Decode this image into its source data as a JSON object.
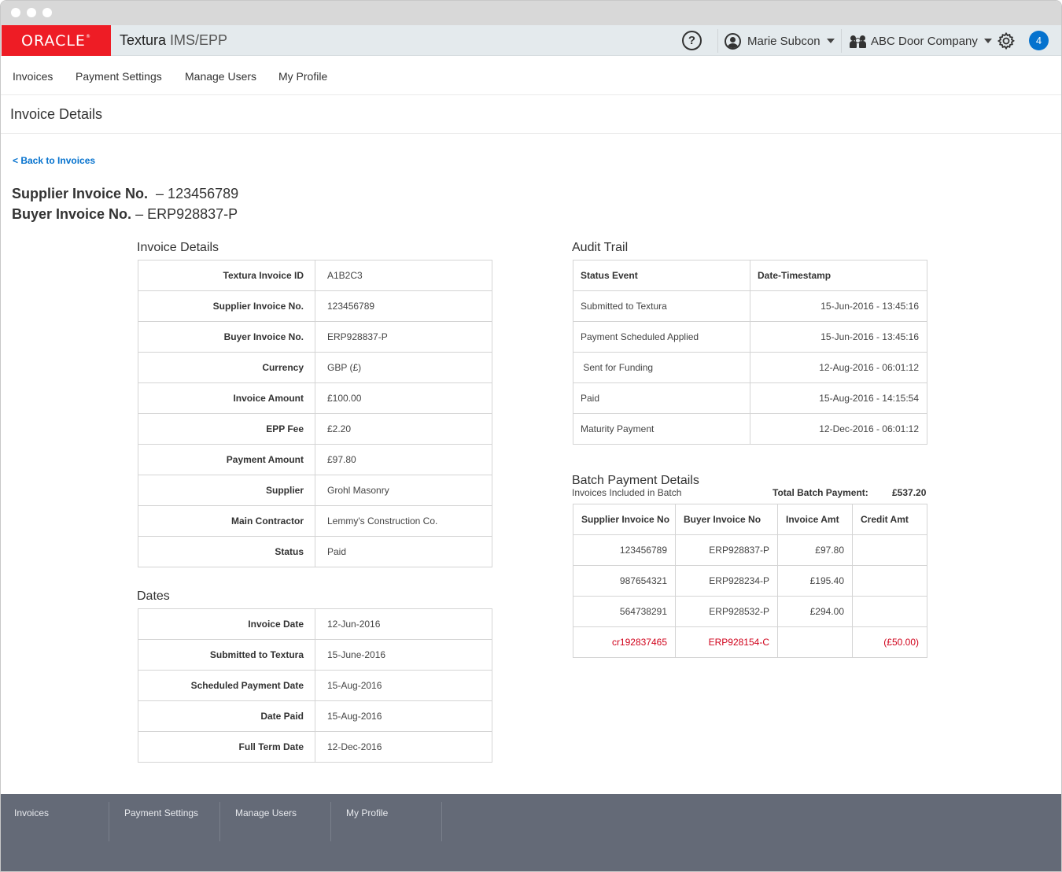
{
  "window": {
    "colors": {
      "titlebar": "#d8d8d8",
      "dots": "#ffffff"
    }
  },
  "topbar": {
    "brand": "ORACLE",
    "brand_color": "#ee1c25",
    "app_title": "Textura",
    "app_title_suffix": " IMS/EPP",
    "help_label": "?",
    "user_name": "Marie Subcon",
    "company_name": "ABC Door Company",
    "notification_count": "4",
    "accent_color": "#0572ce"
  },
  "nav": {
    "items": [
      "Invoices",
      "Payment Settings",
      "Manage Users",
      "My Profile"
    ]
  },
  "page": {
    "title": "Invoice Details",
    "back_link": "< Back to Invoices",
    "supplier_label": "Supplier Invoice No.",
    "supplier_value": "– 123456789",
    "buyer_label": "Buyer Invoice No.",
    "buyer_value": "– ERP928837-P"
  },
  "invoice_details": {
    "title": "Invoice Details",
    "rows": [
      {
        "label": "Textura Invoice ID",
        "value": "A1B2C3"
      },
      {
        "label": "Supplier Invoice No.",
        "value": "123456789"
      },
      {
        "label": "Buyer Invoice No.",
        "value": "ERP928837-P"
      },
      {
        "label": "Currency",
        "value": "GBP (£)"
      },
      {
        "label": "Invoice Amount",
        "value": "£100.00"
      },
      {
        "label": "EPP Fee",
        "value": "£2.20"
      },
      {
        "label": "Payment Amount",
        "value": "£97.80"
      },
      {
        "label": "Supplier",
        "value": "Grohl Masonry"
      },
      {
        "label": "Main Contractor",
        "value": "Lemmy's Construction Co."
      },
      {
        "label": "Status",
        "value": "Paid"
      }
    ]
  },
  "dates": {
    "title": "Dates",
    "rows": [
      {
        "label": "Invoice Date",
        "value": "12-Jun-2016"
      },
      {
        "label": "Submitted to Textura",
        "value": "15-June-2016"
      },
      {
        "label": "Scheduled Payment Date",
        "value": "15-Aug-2016"
      },
      {
        "label": "Date Paid",
        "value": "15-Aug-2016"
      },
      {
        "label": "Full Term Date",
        "value": "12-Dec-2016"
      }
    ]
  },
  "audit_trail": {
    "title": "Audit Trail",
    "headers": [
      "Status Event",
      "Date-Timestamp"
    ],
    "rows": [
      {
        "event": "Submitted to Textura",
        "timestamp": "15-Jun-2016 - 13:45:16"
      },
      {
        "event": "Payment Scheduled Applied",
        "timestamp": "15-Jun-2016 - 13:45:16"
      },
      {
        "event": " Sent for Funding",
        "timestamp": "12-Aug-2016 - 06:01:12"
      },
      {
        "event": "Paid",
        "timestamp": "15-Aug-2016 - 14:15:54"
      },
      {
        "event": "Maturity Payment",
        "timestamp": "12-Dec-2016 - 06:01:12"
      }
    ]
  },
  "batch": {
    "title": "Batch Payment Details",
    "subtitle": "Invoices Included in Batch",
    "total_label": "Total Batch Payment:",
    "total_value": "£537.20",
    "headers": [
      "Supplier Invoice No",
      "Buyer Invoice No",
      "Invoice Amt",
      "Credit Amt"
    ],
    "credit_color": "#d0021b",
    "rows": [
      {
        "supplier": "123456789",
        "buyer": "ERP928837-P",
        "amount": "£97.80",
        "credit": "",
        "is_credit": false
      },
      {
        "supplier": "987654321",
        "buyer": "ERP928234-P",
        "amount": "£195.40",
        "credit": "",
        "is_credit": false
      },
      {
        "supplier": "564738291",
        "buyer": "ERP928532-P",
        "amount": "£294.00",
        "credit": "",
        "is_credit": false
      },
      {
        "supplier": "cr192837465",
        "buyer": "ERP928154-C",
        "amount": "",
        "credit": "(£50.00)",
        "is_credit": true
      }
    ]
  },
  "footer": {
    "items": [
      "Invoices",
      "Payment Settings",
      "Manage Users",
      "My Profile"
    ],
    "background": "#646a77"
  }
}
